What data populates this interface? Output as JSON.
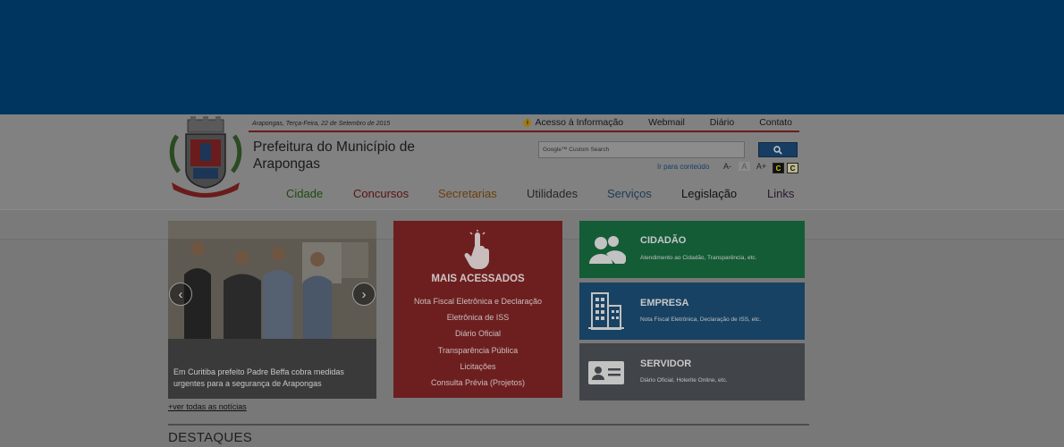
{
  "header": {
    "date": "Arapongas, Terça-Feira, 22 de Setembro de 2015",
    "site_title": "Prefeitura do Município de Arapongas",
    "top_links": [
      "Acesso à Informação",
      "Webmail",
      "Diário",
      "Contato"
    ]
  },
  "search": {
    "placeholder": "Google™ Custom Search"
  },
  "accessibility": {
    "skip_label": "Ir para conteúdo",
    "font_decrease": "A-",
    "font_default": "A",
    "font_increase": "A+",
    "contrast_dark": "C",
    "contrast_light": "C"
  },
  "nav": {
    "items": [
      {
        "label": "Cidade",
        "color": "#1d4a12"
      },
      {
        "label": "Concursos",
        "color": "#5a1212"
      },
      {
        "label": "Secretarias",
        "color": "#6a3f0a"
      },
      {
        "label": "Utilidades",
        "color": "#262626"
      },
      {
        "label": "Serviços",
        "color": "#1d3a55"
      },
      {
        "label": "Legislação",
        "color": "#111111"
      },
      {
        "label": "Links",
        "color": "#2a1830"
      }
    ]
  },
  "slider": {
    "caption": "Em Curitiba prefeito Padre Beffa cobra medidas urgentes para a segurança de Arapongas",
    "more_label": "+ver todas as notícias"
  },
  "most_accessed": {
    "title": "MAIS ACESSADOS",
    "items": [
      "Nota Fiscal Eletrônica e Declaração",
      "Eletrônica de ISS",
      "Diário Oficial",
      "Transparência Pública",
      "Licitações",
      "Consulta Prévia (Projetos)"
    ]
  },
  "tiles": [
    {
      "title": "CIDADÃO",
      "subtitle": "Atendimento ao Cidadão, Transparência, etc.",
      "color": "#135c36",
      "icon": "people-icon"
    },
    {
      "title": "EMPRESA",
      "subtitle": "Nota Fiscal Eletrônica, Declaração de ISS, etc.",
      "color": "#174263",
      "icon": "building-icon"
    },
    {
      "title": "SERVIDOR",
      "subtitle": "Diário Oficial, Holerite Online, etc.",
      "color": "#414549",
      "icon": "id-card-icon"
    }
  ],
  "section": {
    "destaques": "DESTAQUES"
  },
  "colors": {
    "top_band": "#003560",
    "top_rule": "#6b1c1c"
  }
}
